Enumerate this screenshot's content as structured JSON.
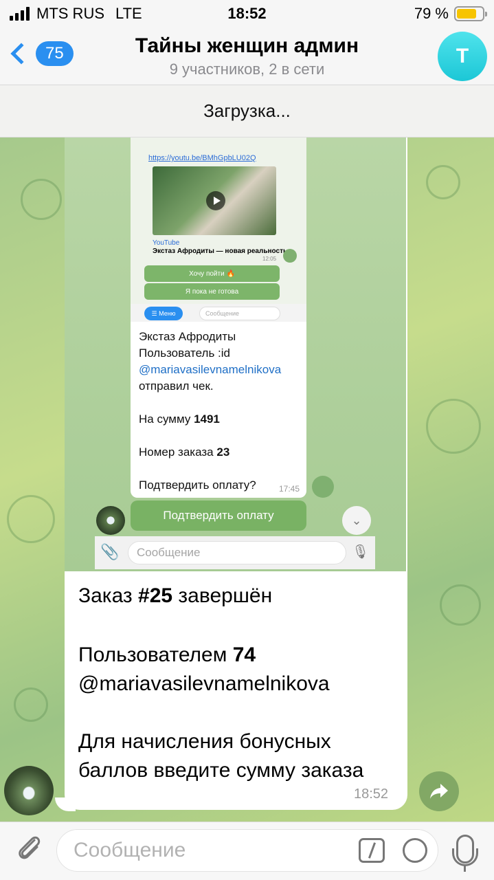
{
  "status": {
    "carrier": "MTS RUS",
    "network": "LTE",
    "time": "18:52",
    "battery": "79 %",
    "battery_level": 0.79
  },
  "header": {
    "back_count": "75",
    "title": "Тайны женщин админ",
    "subtitle": "9 участников, 2 в сети",
    "avatar_letter": "T"
  },
  "loading_text": "Загрузка...",
  "embedded": {
    "link": "https://youtu.be/BMhGpbLU02Q",
    "yt_source": "YouTube",
    "yt_title": "Экстаз Афродиты — новая реальность",
    "yt_time": "12:05",
    "btn_go": "Хочу пойти 🔥",
    "btn_not_ready": "Я пока не готова",
    "menu_label": "☰ Меню",
    "small_input_placeholder": "Сообщение",
    "msg_line1": "Экстаз Афродиты",
    "msg_line2": "Пользователь :id",
    "msg_mention": "@mariavasilevnamelnikova",
    "msg_line3": "отправил чек.",
    "sum_label": "На сумму ",
    "sum_value": "1491",
    "order_label": "Номер заказа ",
    "order_value": "23",
    "confirm_question": "Подтвердить оплату?",
    "msg_time": "17:45",
    "confirm_button": "Подтвердить оплату",
    "input_placeholder": "Сообщение"
  },
  "message": {
    "line1_pre": "Заказ ",
    "line1_bold": "#25",
    "line1_post": " завершён",
    "line2_pre": "Пользователем ",
    "line2_bold": "74",
    "mention": "@mariavasilevnamelnikova",
    "line3": "Для начисления бонусных",
    "line4": "баллов введите сумму заказа",
    "time": "18:52"
  },
  "input": {
    "placeholder": "Сообщение"
  },
  "icons": [
    "signal-icon",
    "battery-icon",
    "back-chevron-icon",
    "play-icon",
    "forward-icon",
    "chevron-down-icon",
    "paperclip-icon",
    "command-icon",
    "sticker-icon",
    "microphone-icon"
  ]
}
